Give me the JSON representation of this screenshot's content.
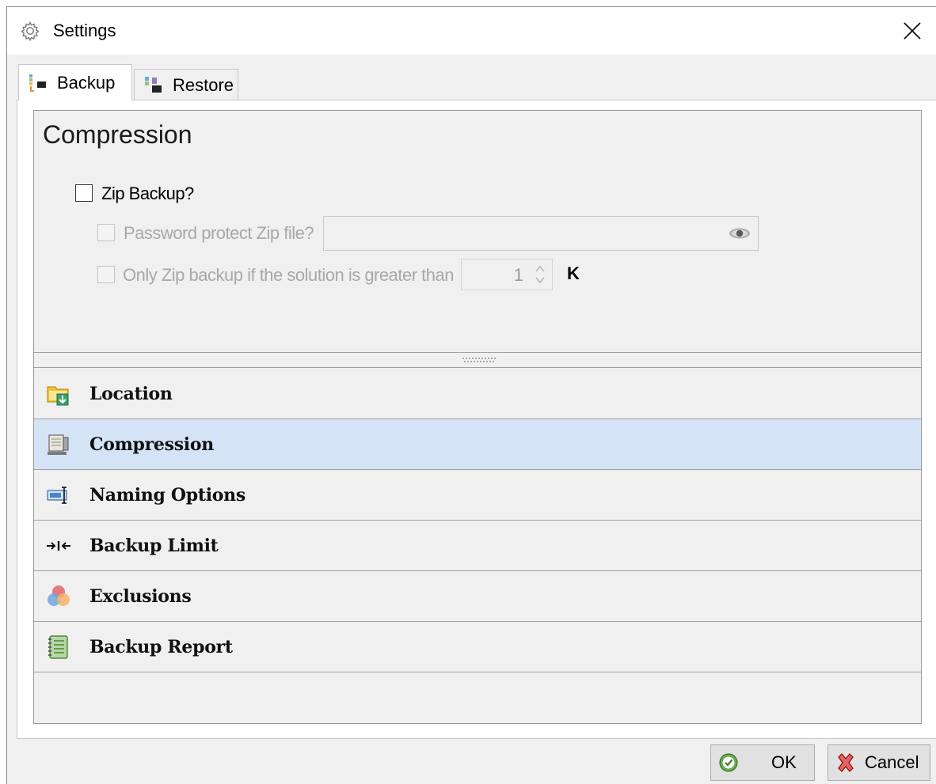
{
  "window": {
    "title": "Settings"
  },
  "tabs": [
    {
      "label": "Backup",
      "active": true
    },
    {
      "label": "Restore",
      "active": false
    }
  ],
  "compression": {
    "heading": "Compression",
    "zip_backup": {
      "label": "Zip Backup?",
      "checked": false
    },
    "password_protect": {
      "label": "Password protect Zip file?",
      "checked": false,
      "enabled": false,
      "value": ""
    },
    "only_zip_if_greater": {
      "label": "Only Zip backup if the solution is greater than",
      "checked": false,
      "enabled": false,
      "value": "1",
      "unit": "K"
    }
  },
  "sections": [
    {
      "label": "Location",
      "icon": "folder-download-icon",
      "selected": false
    },
    {
      "label": "Compression",
      "icon": "compress-vise-icon",
      "selected": true
    },
    {
      "label": "Naming Options",
      "icon": "rename-field-icon",
      "selected": false
    },
    {
      "label": "Backup Limit",
      "icon": "limit-arrows-icon",
      "selected": false
    },
    {
      "label": "Exclusions",
      "icon": "venn-circles-icon",
      "selected": false
    },
    {
      "label": "Backup Report",
      "icon": "report-notebook-icon",
      "selected": false
    }
  ],
  "buttons": {
    "ok": "OK",
    "cancel": "Cancel"
  },
  "colors": {
    "selected_row": "#d4e4f6",
    "panel": "#f0f0f0",
    "border": "#a0a0a0",
    "disabled_text": "#a8a8a8"
  }
}
